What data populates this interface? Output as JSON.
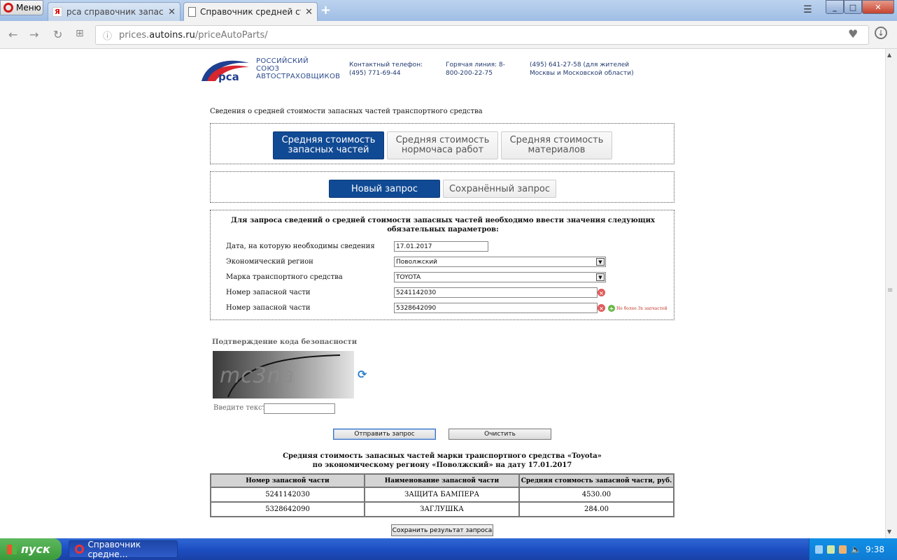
{
  "browser": {
    "menu_label": "Меню",
    "tabs": [
      {
        "title": "рса справочник запасных ч"
      },
      {
        "title": "Справочник средней стоим"
      }
    ],
    "url_prefix": "prices.",
    "url_domain": "autoins.ru",
    "url_path": "/priceAutoParts/"
  },
  "header": {
    "logo_abbr": "рса",
    "logo_line1": "РОССИЙСКИЙ",
    "logo_line2": "СОЮЗ",
    "logo_line3": "АВТОСТРАХОВЩИКОВ",
    "contact1": "Контактный телефон: (495) 771-69-44",
    "contact2": "Горячая линия: 8-800-200-22-75",
    "contact3": "(495) 641-27-58 (для жителей Москвы и Московской области)"
  },
  "section_title": "Сведения о средней стоимости запасных частей транспортного средства",
  "main_tabs": [
    {
      "line1": "Средняя стоимость",
      "line2": "запасных частей"
    },
    {
      "line1": "Средняя стоимость",
      "line2": "нормочаса работ"
    },
    {
      "line1": "Средняя стоимость",
      "line2": "материалов"
    }
  ],
  "sub_tabs": [
    "Новый запрос",
    "Сохранённый запрос"
  ],
  "form": {
    "heading": "Для запроса сведений о средней стоимости запасных частей необходимо ввести значения следующих обязательных параметров:",
    "date_label": "Дата, на которую необходимы сведения",
    "date_value": "17.01.2017",
    "region_label": "Экономический регион",
    "region_value": "Поволжский",
    "brand_label": "Марка транспортного средства",
    "brand_value": "TOYOTA",
    "part1_label": "Номер запасной части",
    "part1_value": "5241142030",
    "part2_label": "Номер запасной части",
    "part2_value": "5328642090",
    "add_note": "Не более 3х запчастей"
  },
  "captcha": {
    "title": "Подтверждение кода безопасности",
    "image_text": "mc3na",
    "input_label": "Введите текст:"
  },
  "buttons": {
    "submit": "Отправить запрос",
    "clear": "Очистить",
    "save": "Сохранить результат запроса"
  },
  "result": {
    "title_line1": "Средняя стоимость запасных частей марки транспортного средства «Toyota»",
    "title_line2": "по экономическому региону «Поволжский» на дату 17.01.2017",
    "columns": [
      "Номер запасной части",
      "Наименование запасной части",
      "Средняя стоимость запасной части, руб."
    ],
    "rows": [
      [
        "5241142030",
        "ЗАЩИТА БАМПЕРА",
        "4530.00"
      ],
      [
        "5328642090",
        "ЗАГЛУШКА",
        "284.00"
      ]
    ]
  },
  "taskbar": {
    "start_label": "пуск",
    "task_label": "Справочник средне…",
    "clock": "9:38"
  },
  "colors": {
    "brand_blue": "#114a94",
    "taskbar_blue": "#1d4fc2",
    "start_green": "#3a9a3a"
  }
}
